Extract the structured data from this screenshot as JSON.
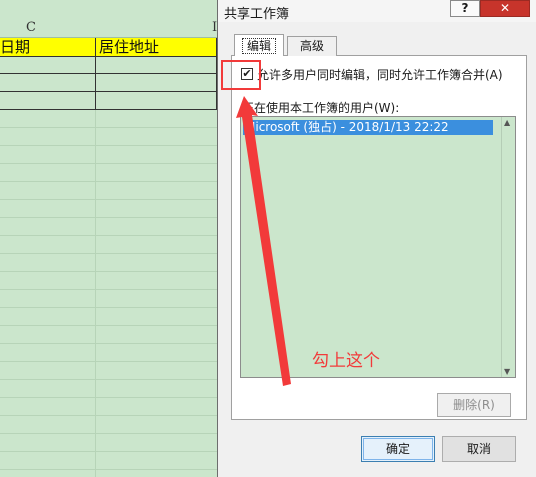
{
  "spreadsheet": {
    "column_letters": [
      "C",
      "I"
    ],
    "headers": [
      "日期",
      "居住地址"
    ],
    "header_fill": "#ffff00"
  },
  "dialog": {
    "title": "共享工作簿",
    "help_label": "?",
    "close_label": "✕",
    "tabs": [
      {
        "label": "编辑",
        "selected": true
      },
      {
        "label": "高级",
        "selected": false
      }
    ],
    "allow_multi_user": {
      "checked": true,
      "check_mark": "✔",
      "label": "允许多用户同时编辑，同时允许工作簿合并(A)"
    },
    "users_label": "正在使用本工作簿的用户(W):",
    "users": [
      "Microsoft (独占) - 2018/1/13 22:22"
    ],
    "scroll_up": "▲",
    "scroll_down": "▼",
    "remove_button": "删除(R)",
    "ok_button": "确定",
    "cancel_button": "取消"
  },
  "annotation": {
    "text": "勾上这个",
    "color": "#f23a3a"
  },
  "icons": [
    "help-icon",
    "close-icon",
    "checkmark-icon",
    "scroll-up-icon",
    "scroll-down-icon"
  ]
}
